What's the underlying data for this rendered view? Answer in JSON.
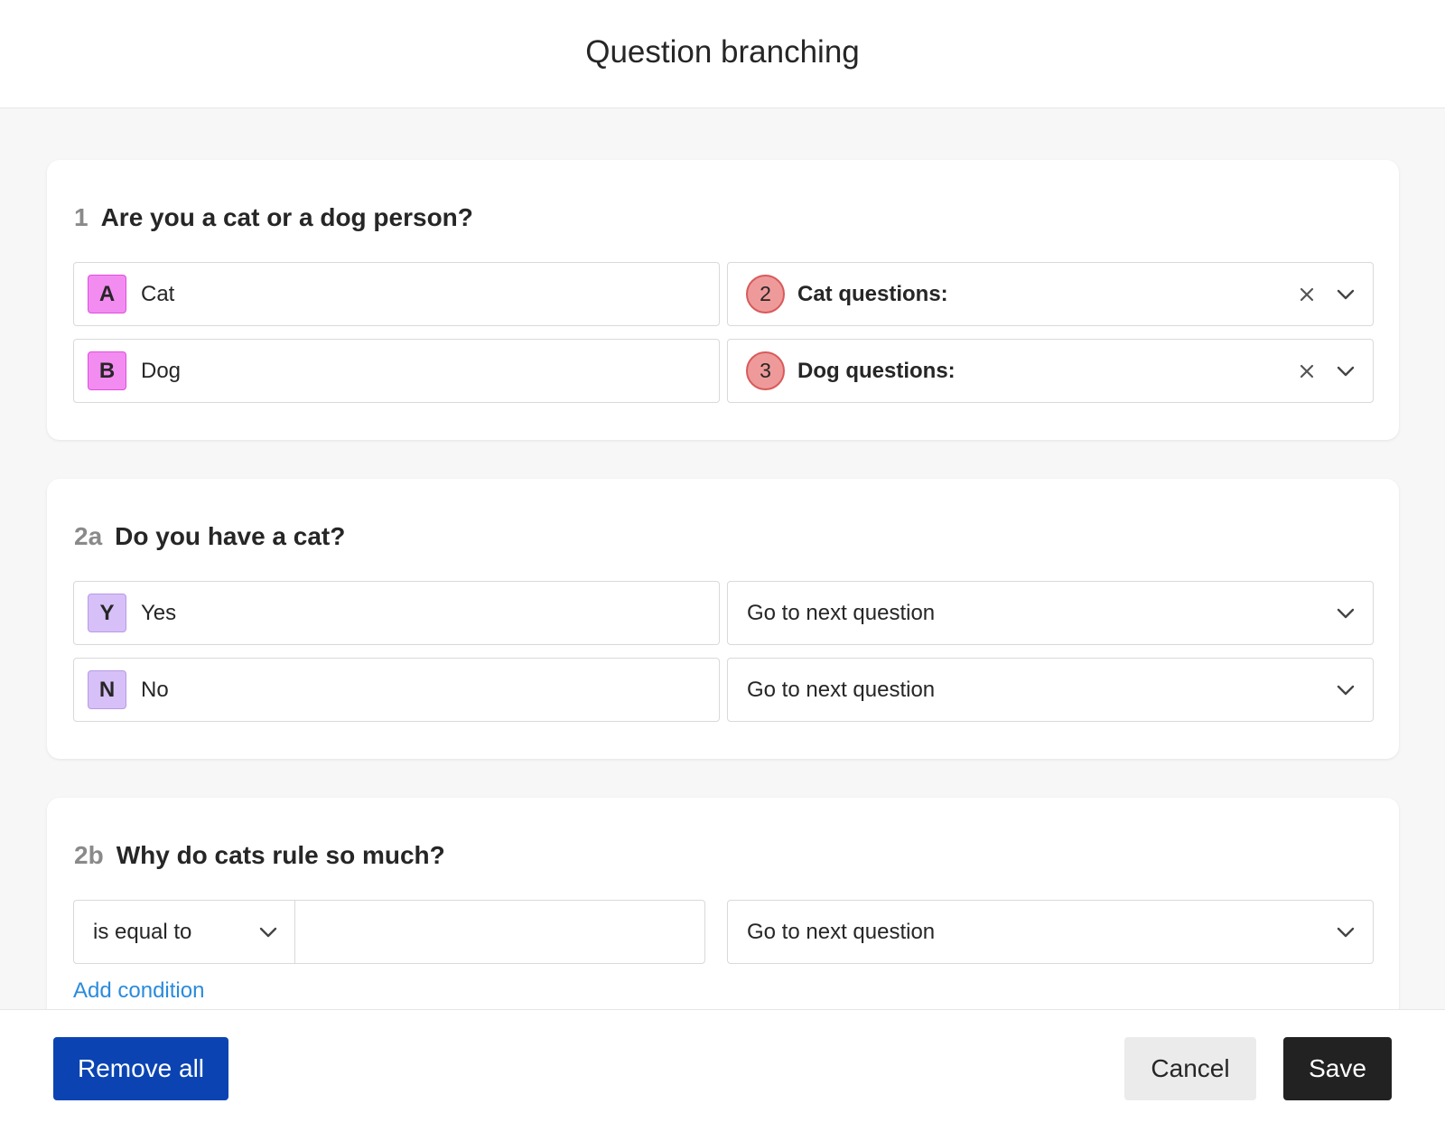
{
  "header": {
    "title": "Question branching"
  },
  "questions": [
    {
      "number": "1",
      "title": "Are you a cat or a dog person?",
      "answers": [
        {
          "letter": "A",
          "label": "Cat",
          "target_number": "2",
          "target_label": "Cat questions:"
        },
        {
          "letter": "B",
          "label": "Dog",
          "target_number": "3",
          "target_label": "Dog questions:"
        }
      ]
    },
    {
      "number": "2a",
      "title": "Do you have a cat?",
      "answers": [
        {
          "letter": "Y",
          "label": "Yes",
          "target_label": "Go to next question"
        },
        {
          "letter": "N",
          "label": "No",
          "target_label": "Go to next question"
        }
      ]
    },
    {
      "number": "2b",
      "title": "Why do cats rule so much?",
      "condition": {
        "operator": "is equal to",
        "value": "",
        "target_label": "Go to next question"
      },
      "add_condition_label": "Add condition"
    }
  ],
  "footer": {
    "remove_all_label": "Remove all",
    "cancel_label": "Cancel",
    "save_label": "Save"
  },
  "colors": {
    "primary_button": "#0b44b2",
    "save_button": "#222222",
    "link": "#2a8bdc",
    "letter_pink": "#f28cf0",
    "letter_purple": "#d6c0f7",
    "target_badge": "#ef9a9a"
  }
}
